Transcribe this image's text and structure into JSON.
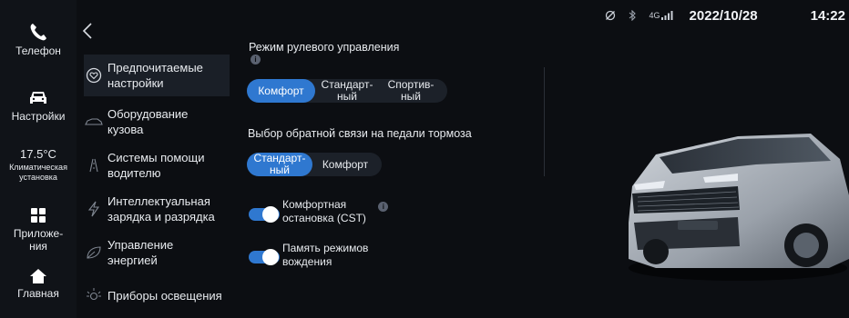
{
  "status_bar": {
    "icons": [
      "no-sync-icon",
      "bluetooth-icon",
      "signal-4g-icon"
    ],
    "network": "4G",
    "date": "2022/10/28",
    "time": "14:22"
  },
  "rail": {
    "phone": {
      "label": "Телефон",
      "icon": "phone-icon"
    },
    "settings": {
      "label": "Настройки",
      "icon": "car-icon"
    },
    "climate": {
      "temp": "17.5°C",
      "label": "Климатическая установка"
    },
    "apps": {
      "label": "Приложе-ния",
      "icon": "grid-icon"
    },
    "home": {
      "label": "Главная",
      "icon": "home-icon"
    }
  },
  "menu": {
    "back_icon": "chevron-left-icon",
    "items": [
      {
        "label": "Предпочитаемые настройки",
        "icon": "heart-circle-icon",
        "active": true
      },
      {
        "label": "Оборудование кузова",
        "icon": "car-body-icon",
        "active": false
      },
      {
        "label": "Системы помощи водителю",
        "icon": "lane-assist-icon",
        "active": false
      },
      {
        "label": "Интеллектуальная зарядка и разрядка",
        "icon": "lightning-icon",
        "active": false
      },
      {
        "label": "Управление энергией",
        "icon": "leaf-icon",
        "active": false
      },
      {
        "label": "Приборы освещения",
        "icon": "sun-icon",
        "active": false
      }
    ]
  },
  "steering": {
    "title": "Режим рулевого управления",
    "info": "i",
    "options": [
      "Комфорт",
      "Стандарт-ный",
      "Спортив-ный"
    ],
    "selected": "Комфорт"
  },
  "brake": {
    "title": "Выбор обратной связи на педали тормоза",
    "options": [
      "Стандарт-ный",
      "Комфорт"
    ],
    "selected": "Стандарт-ный"
  },
  "toggles": {
    "cst": {
      "label": "Комфортная остановка (CST)",
      "tag": "(CST)",
      "info": "i",
      "on": true
    },
    "memory": {
      "label": "Память режимов вождения",
      "on": true
    }
  },
  "colors": {
    "accent": "#2f78d0",
    "background": "#0c0e12"
  }
}
